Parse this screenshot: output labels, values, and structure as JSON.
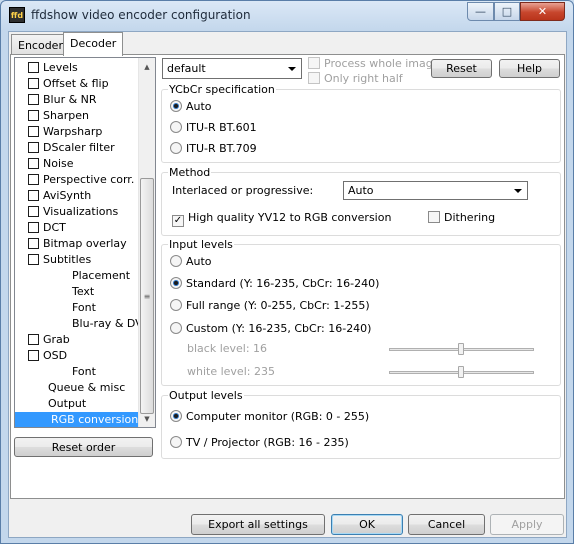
{
  "window": {
    "title": "ffdshow video encoder configuration",
    "app_icon_text": "ffd"
  },
  "caption_buttons": {
    "minimize": "—",
    "maximize": "□",
    "close": "✕"
  },
  "tabs": [
    {
      "label": "Encoder",
      "active": false
    },
    {
      "label": "Decoder",
      "active": true
    }
  ],
  "tree": {
    "items": [
      {
        "label": "Levels",
        "checkbox": true
      },
      {
        "label": "Offset & flip",
        "checkbox": true
      },
      {
        "label": "Blur & NR",
        "checkbox": true
      },
      {
        "label": "Sharpen",
        "checkbox": true
      },
      {
        "label": "Warpsharp",
        "checkbox": true
      },
      {
        "label": "DScaler filter",
        "checkbox": true
      },
      {
        "label": "Noise",
        "checkbox": true
      },
      {
        "label": "Perspective corr.",
        "checkbox": true
      },
      {
        "label": "AviSynth",
        "checkbox": true
      },
      {
        "label": "Visualizations",
        "checkbox": true
      },
      {
        "label": "DCT",
        "checkbox": true
      },
      {
        "label": "Bitmap overlay",
        "checkbox": true
      },
      {
        "label": "Subtitles",
        "checkbox": true
      },
      {
        "label": "Placement",
        "checkbox": false
      },
      {
        "label": "Text",
        "checkbox": false
      },
      {
        "label": "Font",
        "checkbox": false
      },
      {
        "label": "Blu-ray & DVD",
        "checkbox": false
      },
      {
        "label": "Grab",
        "checkbox": true
      },
      {
        "label": "OSD",
        "checkbox": true
      },
      {
        "label": "Font",
        "checkbox": false
      },
      {
        "label": "Queue & misc",
        "checkbox": false
      },
      {
        "label": "Output",
        "checkbox": false
      },
      {
        "label": "RGB conversion",
        "checkbox": false,
        "selected": true
      }
    ],
    "scroll_up": "▲",
    "scroll_down": "▼",
    "thumb_grip": "≡"
  },
  "reset_order_label": "Reset order",
  "preset": {
    "value": "default"
  },
  "process_whole_image": {
    "label": "Process whole image",
    "checked": false,
    "enabled": false
  },
  "only_right_half": {
    "label": "Only right half",
    "checked": false,
    "enabled": false
  },
  "reset_label": "Reset",
  "help_label": "Help",
  "ycbcr": {
    "title": "YCbCr specification",
    "options": [
      {
        "label": "Auto",
        "selected": true
      },
      {
        "label": "ITU-R BT.601",
        "selected": false
      },
      {
        "label": "ITU-R BT.709",
        "selected": false
      }
    ]
  },
  "method": {
    "title": "Method",
    "interlaced_label": "Interlaced or progressive:",
    "interlaced_value": "Auto",
    "hq_label": "High quality YV12 to RGB conversion",
    "hq_checked": true,
    "check_mark": "✓",
    "dithering_label": "Dithering",
    "dithering_checked": false
  },
  "input_levels": {
    "title": "Input levels",
    "options": [
      {
        "label": "Auto",
        "selected": false
      },
      {
        "label": "Standard  (Y: 16-235, CbCr: 16-240)",
        "selected": true
      },
      {
        "label": "Full range  (Y: 0-255, CbCr: 1-255)",
        "selected": false
      },
      {
        "label": "Custom (Y: 16-235, CbCr: 16-240)",
        "selected": false
      }
    ],
    "black_level_label": "black level: 16",
    "white_level_label": "white level: 235",
    "black_level_value": 16,
    "white_level_value": 235
  },
  "output_levels": {
    "title": "Output levels",
    "options": [
      {
        "label": "Computer monitor  (RGB: 0 - 255)",
        "selected": true
      },
      {
        "label": "TV / Projector  (RGB: 16 - 235)",
        "selected": false
      }
    ]
  },
  "footer": {
    "export_label": "Export all settings",
    "ok_label": "OK",
    "cancel_label": "Cancel",
    "apply_label": "Apply"
  },
  "colors": {
    "selection": "#3399ff",
    "title_bar": "#c3d7ec",
    "close_button": "#c7462d"
  }
}
